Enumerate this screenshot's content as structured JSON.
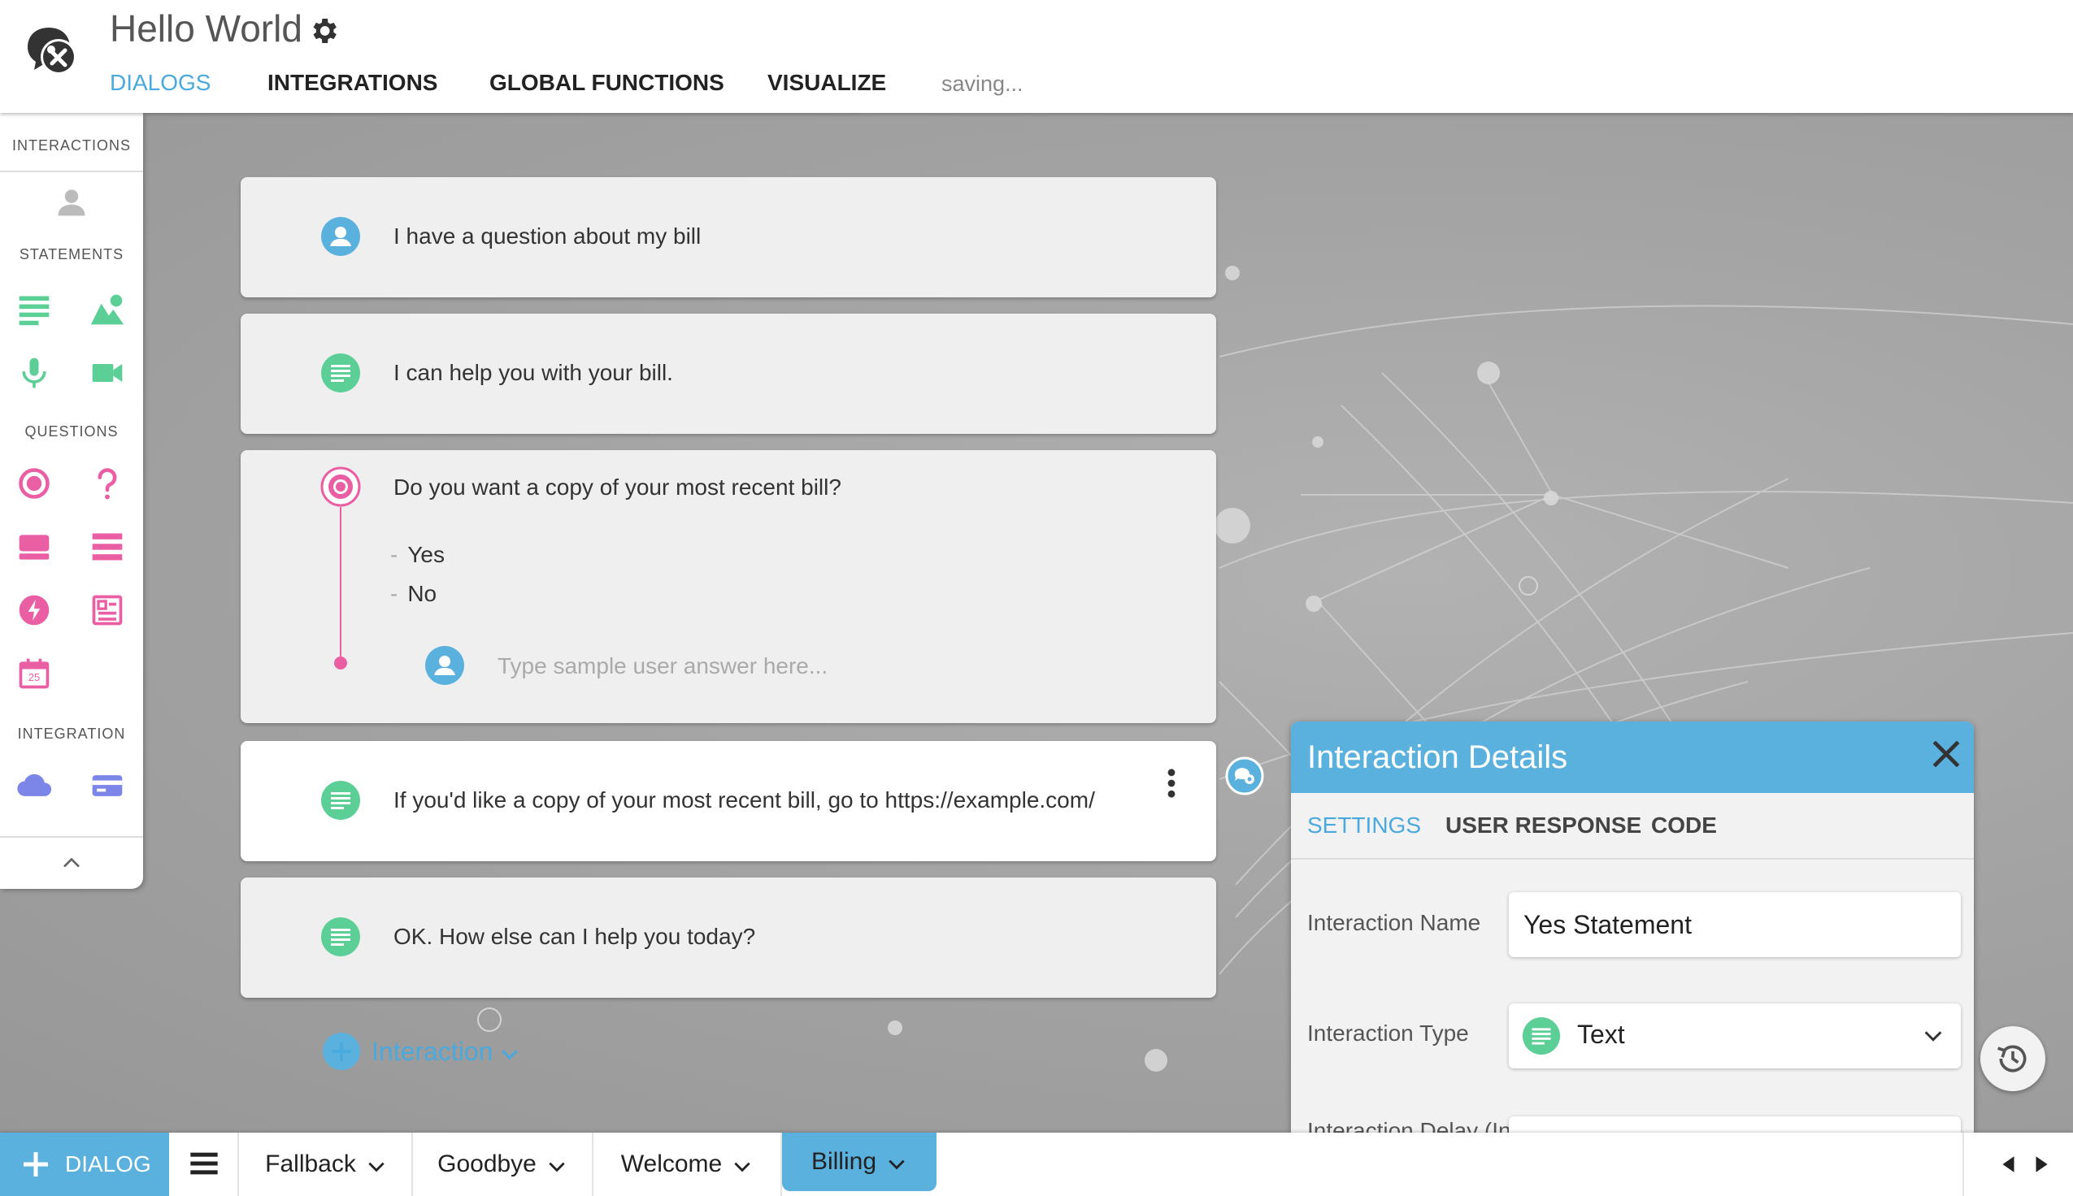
{
  "app": {
    "title": "Hello World"
  },
  "nav": {
    "tabs": [
      {
        "label": "DIALOGS"
      },
      {
        "label": "INTEGRATIONS"
      },
      {
        "label": "GLOBAL FUNCTIONS"
      },
      {
        "label": "VISUALIZE"
      }
    ],
    "active": "DIALOGS",
    "status": "saving..."
  },
  "sidebar": {
    "sections": {
      "interactions": "INTERACTIONS",
      "statements": "STATEMENTS",
      "questions": "QUESTIONS",
      "integration": "INTEGRATION"
    },
    "calendar_day": "25",
    "icons": {
      "interactions": [
        "user-icon"
      ],
      "statements": [
        "text-statement-icon",
        "image-statement-icon",
        "audio-statement-icon",
        "video-statement-icon"
      ],
      "questions": [
        "single-choice-icon",
        "question-icon",
        "card-icon",
        "list-icon",
        "action-icon",
        "form-icon",
        "date-icon"
      ],
      "integration": [
        "cloud-icon",
        "payment-icon"
      ]
    }
  },
  "dialog": {
    "interactions": [
      {
        "type": "user",
        "text": "I have a question about my bill"
      },
      {
        "type": "text",
        "text": "I can help you with your bill."
      },
      {
        "type": "question",
        "text": "Do you want a copy of your most recent bill?",
        "options": [
          "Yes",
          "No"
        ],
        "answer_placeholder": "Type sample user answer here..."
      },
      {
        "type": "text",
        "text": "If you'd like a copy of your most recent bill, go to https://example.com/",
        "selected": true
      },
      {
        "type": "text",
        "text": "OK. How else can I help you today?"
      }
    ],
    "add_button": "Interaction"
  },
  "details": {
    "title": "Interaction Details",
    "tabs": [
      "SETTINGS",
      "USER RESPONSE",
      "CODE"
    ],
    "active_tab": "SETTINGS",
    "fields": {
      "name_label": "Interaction Name",
      "name_value": "Yes Statement",
      "type_label": "Interaction Type",
      "type_value": "Text",
      "delay_label": "Interaction Delay (In"
    }
  },
  "bottom": {
    "add_dialog": "DIALOG",
    "dialogs": [
      "Fallback",
      "Goodbye",
      "Welcome",
      "Billing"
    ],
    "active": "Billing"
  },
  "colors": {
    "accent": "#5bb1de",
    "link": "#4aa9dd",
    "statement": "#5ccf96",
    "question": "#ea5fa4",
    "integration": "#7b86e8",
    "user": "#5bb1de"
  }
}
